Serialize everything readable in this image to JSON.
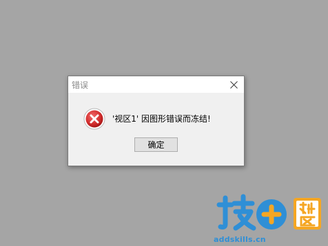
{
  "dialog": {
    "title": "错误",
    "message": "'视区1' 因图形错误而冻结!",
    "ok_label": "确定"
  },
  "icons": {
    "close": "close-icon",
    "error": "error-icon"
  },
  "watermark": {
    "logo_text": "技⊕社区",
    "site": "addskills.cn"
  },
  "colors": {
    "background": "#a5a5a5",
    "dialog_bg": "#f0f0f0",
    "error_red": "#d93a3a",
    "watermark_blue": "#2f8fd6",
    "watermark_orange": "#f5a623"
  }
}
